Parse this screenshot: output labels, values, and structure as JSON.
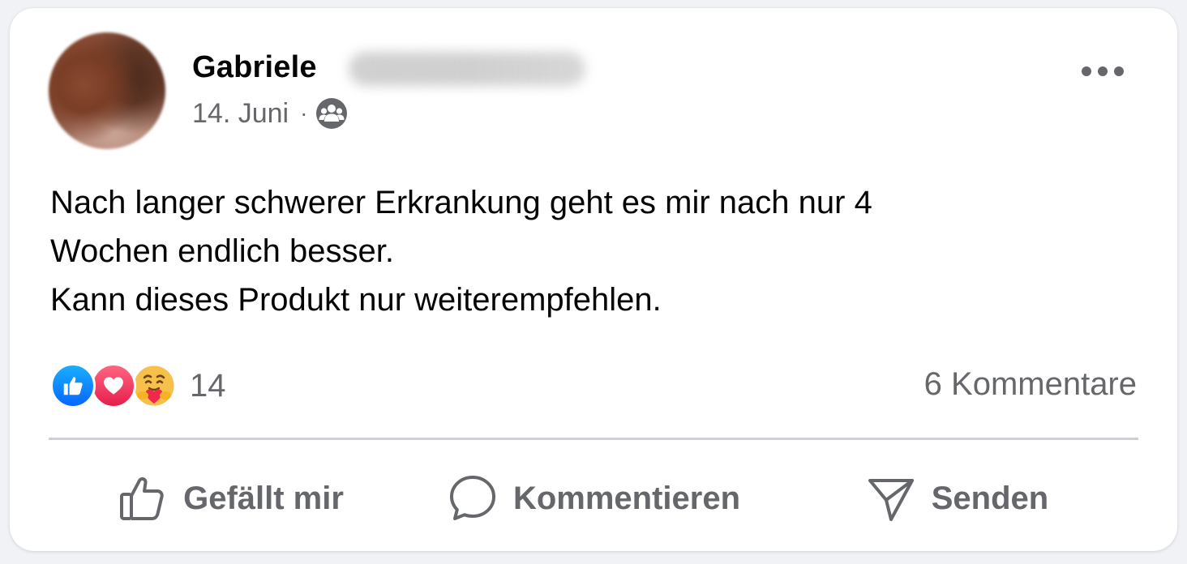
{
  "post": {
    "author_name": "Gabriele",
    "date": "14. Juni",
    "separator": "·",
    "audience_icon": "friends-icon",
    "more_icon": "more-options-icon",
    "text": "Nach langer schwerer Erkrankung geht es mir nach nur 4\nWochen endlich besser.\nKann dieses Produkt nur weiterempfehlen."
  },
  "reactions": {
    "types": [
      "like",
      "love",
      "care"
    ],
    "count": "14",
    "colors": {
      "like": "#0866ff",
      "love": "#e61e4d",
      "care": "#f7b125"
    }
  },
  "comments": {
    "count_label": "6 Kommentare"
  },
  "actions": {
    "like_label": "Gefällt mir",
    "comment_label": "Kommentieren",
    "send_label": "Senden"
  },
  "colors": {
    "primary_text": "#050505",
    "secondary_text": "#65676b",
    "divider": "#ced0d4",
    "background": "#ffffff"
  }
}
